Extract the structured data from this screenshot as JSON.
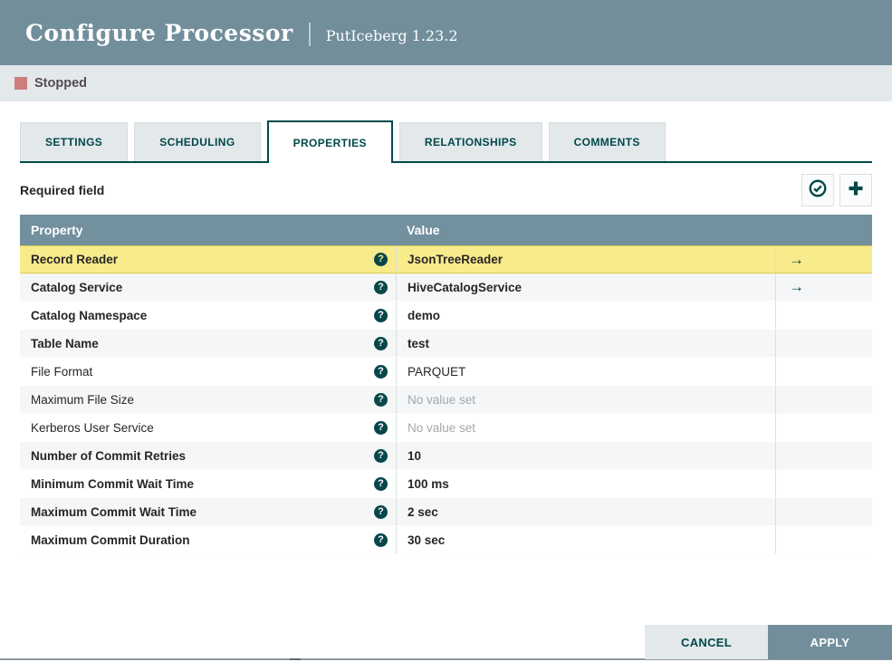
{
  "dialog": {
    "title": "Configure Processor",
    "subtitle": "PutIceberg 1.23.2",
    "status": {
      "label": "Stopped"
    },
    "tabs": [
      {
        "label": "SETTINGS",
        "active": false
      },
      {
        "label": "SCHEDULING",
        "active": false
      },
      {
        "label": "PROPERTIES",
        "active": true
      },
      {
        "label": "RELATIONSHIPS",
        "active": false
      },
      {
        "label": "COMMENTS",
        "active": false
      }
    ],
    "required_field_label": "Required field",
    "table": {
      "columns": [
        "Property",
        "Value"
      ],
      "rows": [
        {
          "property": "Record Reader",
          "value": "JsonTreeReader",
          "required": true,
          "unset": false,
          "selected": true,
          "has_goto": true
        },
        {
          "property": "Catalog Service",
          "value": "HiveCatalogService",
          "required": true,
          "unset": false,
          "selected": false,
          "has_goto": true
        },
        {
          "property": "Catalog Namespace",
          "value": "demo",
          "required": true,
          "unset": false,
          "selected": false,
          "has_goto": false
        },
        {
          "property": "Table Name",
          "value": "test",
          "required": true,
          "unset": false,
          "selected": false,
          "has_goto": false
        },
        {
          "property": "File Format",
          "value": "PARQUET",
          "required": false,
          "unset": false,
          "selected": false,
          "has_goto": false
        },
        {
          "property": "Maximum File Size",
          "value": "No value set",
          "required": false,
          "unset": true,
          "selected": false,
          "has_goto": false
        },
        {
          "property": "Kerberos User Service",
          "value": "No value set",
          "required": false,
          "unset": true,
          "selected": false,
          "has_goto": false
        },
        {
          "property": "Number of Commit Retries",
          "value": "10",
          "required": true,
          "unset": false,
          "selected": false,
          "has_goto": false
        },
        {
          "property": "Minimum Commit Wait Time",
          "value": "100 ms",
          "required": true,
          "unset": false,
          "selected": false,
          "has_goto": false
        },
        {
          "property": "Maximum Commit Wait Time",
          "value": "2 sec",
          "required": true,
          "unset": false,
          "selected": false,
          "has_goto": false
        },
        {
          "property": "Maximum Commit Duration",
          "value": "30 sec",
          "required": true,
          "unset": false,
          "selected": false,
          "has_goto": false
        }
      ]
    },
    "buttons": {
      "cancel": "CANCEL",
      "apply": "APPLY"
    },
    "colors": {
      "accent_teal": "#004849",
      "header_slate": "#728E9B",
      "status_bar_bg": "#E3E8EB",
      "stopped_red": "#CE7D7D",
      "selected_row_yellow": "#F8EB8B",
      "alt_row_gray": "#F4F6F7",
      "table_header_slate": "#72909E"
    }
  }
}
